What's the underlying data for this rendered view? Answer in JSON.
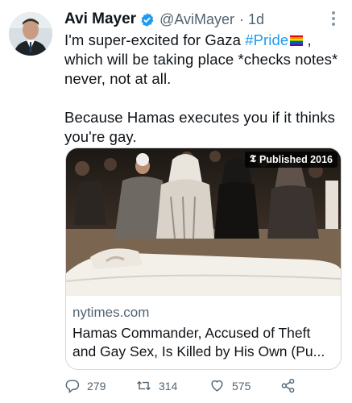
{
  "tweet": {
    "display_name": "Avi Mayer",
    "handle": "@AviMayer",
    "time": "· 1d",
    "text_line1_pre": "I'm super-excited for Gaza ",
    "hashtag": "#Pride",
    "text_line1_post": " ,",
    "text_rest": "which will be taking place *checks notes* never, not at all.",
    "text_paragraph2": "Because Hamas executes you if it thinks you're gay."
  },
  "card": {
    "badge_logo": "𝕿",
    "badge_text": "Published 2016",
    "domain": "nytimes.com",
    "title_line1": "Hamas Commander, Accused of Theft",
    "title_line2": "and Gay Sex, Is Killed by His Own (Pu..."
  },
  "actions": {
    "replies": "279",
    "retweets": "314",
    "likes": "575"
  },
  "colors": {
    "link": "#1d9bf0",
    "muted": "#536471",
    "verified": "#1d9bf0"
  },
  "icons": [
    "verified-badge-icon",
    "more-options-icon",
    "reply-icon",
    "retweet-icon",
    "like-icon",
    "share-icon"
  ]
}
